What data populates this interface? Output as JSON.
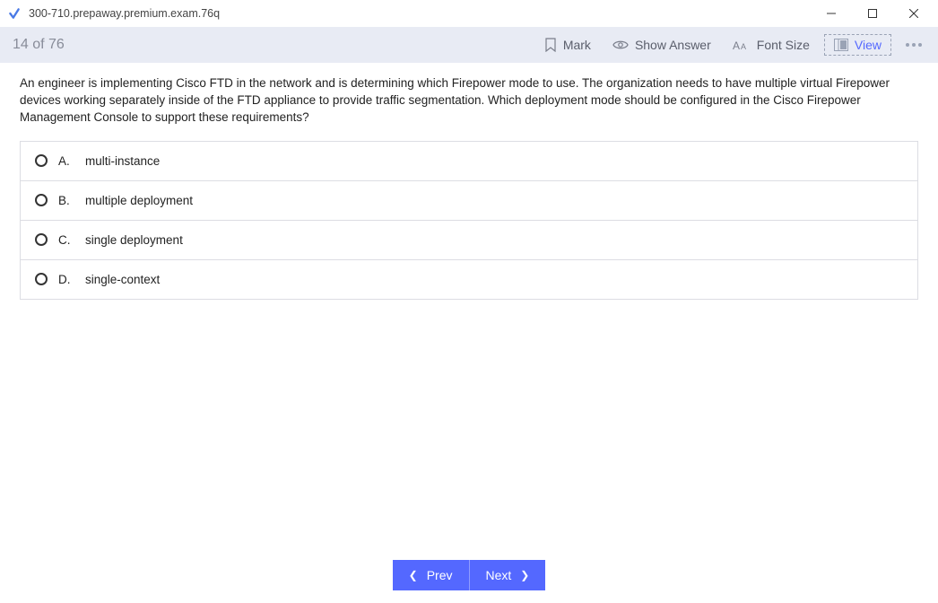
{
  "window": {
    "title": "300-710.prepaway.premium.exam.76q"
  },
  "toolbar": {
    "counter": "14 of 76",
    "mark": "Mark",
    "show_answer": "Show Answer",
    "font_size": "Font Size",
    "view": "View"
  },
  "question": {
    "text": "An engineer is implementing Cisco FTD in the network and is determining which Firepower mode to use. The organization needs to have multiple virtual Firepower devices working separately inside of the FTD appliance to provide traffic segmentation. Which deployment mode should be configured in the Cisco Firepower Management Console to support these requirements?",
    "options": [
      {
        "letter": "A.",
        "text": "multi-instance"
      },
      {
        "letter": "B.",
        "text": "multiple deployment"
      },
      {
        "letter": "C.",
        "text": "single deployment"
      },
      {
        "letter": "D.",
        "text": "single-context"
      }
    ]
  },
  "nav": {
    "prev": "Prev",
    "next": "Next"
  }
}
